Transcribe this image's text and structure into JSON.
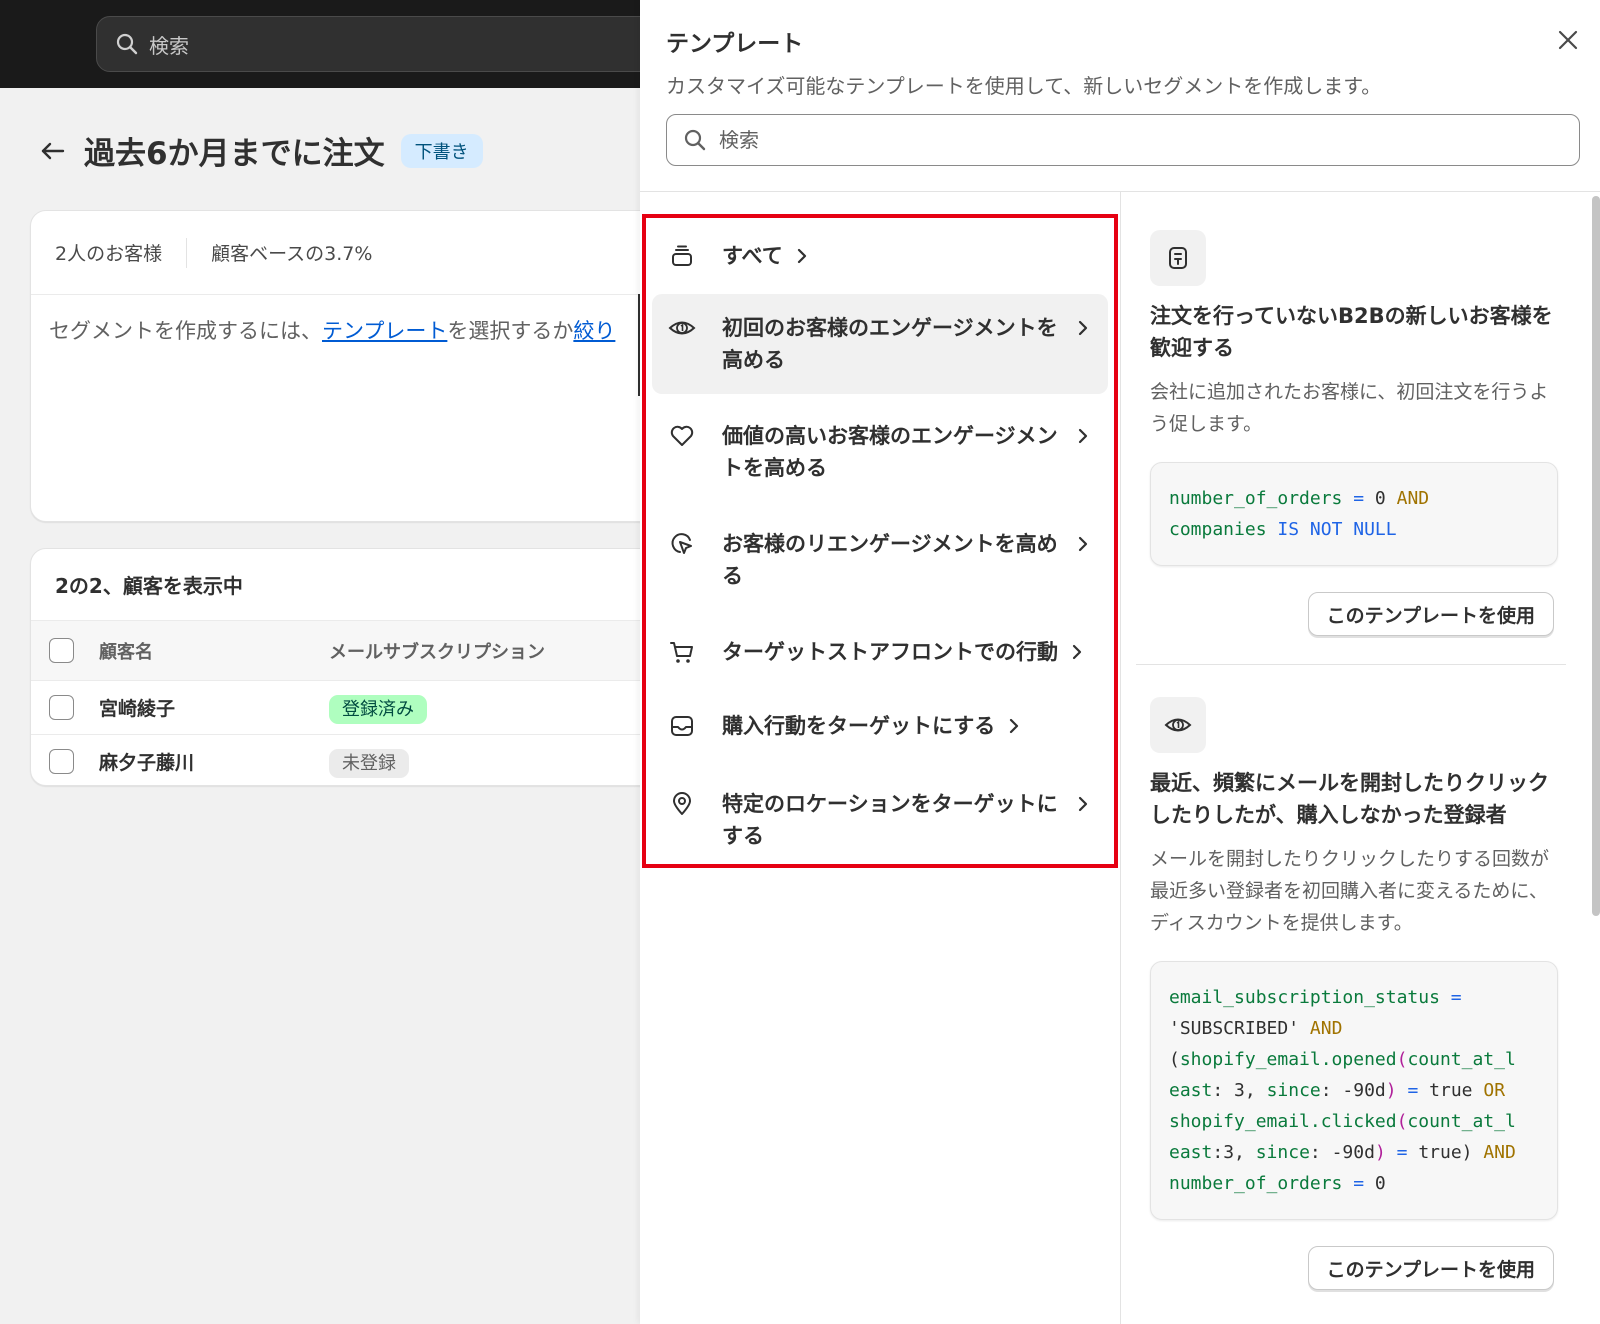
{
  "topbar": {
    "search_placeholder": "検索"
  },
  "page": {
    "title": "過去6か月までに注文",
    "badge": "下書き",
    "stats": {
      "customers": "2人のお客様",
      "base_share": "顧客ベースの3.7%"
    },
    "hint": {
      "prefix": "セグメントを作成するには、",
      "link_template": "テンプレート",
      "middle": "を選択するか",
      "link_filter": "絞り"
    },
    "list": {
      "heading": "2の2、顧客を表示中",
      "col_name": "顧客名",
      "col_sub": "メールサブスクリプション",
      "rows": [
        {
          "name": "宮崎綾子",
          "status": "登録済み"
        },
        {
          "name": "麻夕子藤川",
          "status": "未登録"
        }
      ]
    }
  },
  "panel": {
    "title": "テンプレート",
    "subtitle": "カスタマイズ可能なテンプレートを使用して、新しいセグメントを作成します。",
    "search_placeholder": "検索",
    "categories": [
      {
        "label": "すべて",
        "icon": "stack-icon"
      },
      {
        "label": "初回のお客様のエンゲージメントを高める",
        "icon": "first-order-icon",
        "active": true
      },
      {
        "label": "価値の高いお客様のエンゲージメントを高める",
        "icon": "heart-icon"
      },
      {
        "label": "お客様のリエンゲージメントを高める",
        "icon": "cursor-click-icon"
      },
      {
        "label": "ターゲットストアフロントでの行動",
        "icon": "cart-icon"
      },
      {
        "label": "購入行動をターゲットにする",
        "icon": "inbox-icon"
      },
      {
        "label": "特定のロケーションをターゲットにする",
        "icon": "location-pin-icon"
      }
    ],
    "templates": [
      {
        "icon": "b2b-icon",
        "title": "注文を行っていないB2Bの新しいお客様を歓迎する",
        "description": "会社に追加されたお客様に、初回注文を行うよう促します。",
        "query": "number_of_orders = 0 AND companies IS NOT NULL",
        "button": "このテンプレートを使用"
      },
      {
        "icon": "first-order-icon",
        "title": "最近、頻繁にメールを開封したりクリックしたりしたが、購入しなかった登録者",
        "description": "メールを開封したりクリックしたりする回数が最近多い登録者を初回購入者に変えるために、ディスカウントを提供します。",
        "query": "email_subscription_status = 'SUBSCRIBED' AND (shopify_email.opened(count_at_least: 3, since: -90d) = true OR shopify_email.clicked(count_at_least:3, since: -90d) = true) AND number_of_orders = 0",
        "button": "このテンプレートを使用"
      }
    ]
  },
  "colors": {
    "highlight_border": "#e60012",
    "link": "#005bd3",
    "code_identifier": "#0a7a3c",
    "code_operator": "#1f64e6",
    "code_keyword": "#a07300"
  }
}
